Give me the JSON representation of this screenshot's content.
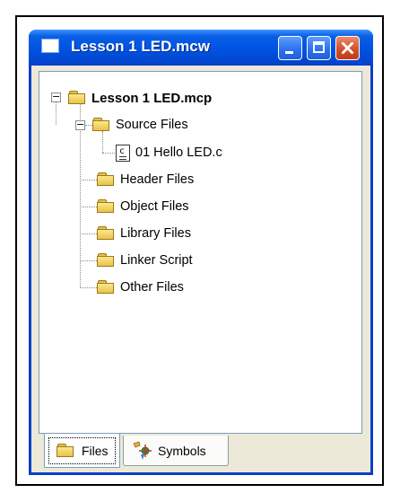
{
  "window": {
    "title": "Lesson 1 LED.mcw",
    "buttons": [
      "minimize",
      "maximize",
      "close"
    ]
  },
  "tree": {
    "project": "Lesson 1 LED.mcp",
    "source_folder": "Source Files",
    "source_file": "01 Hello LED.c",
    "folders": [
      "Header Files",
      "Object Files",
      "Library Files",
      "Linker Script",
      "Other Files"
    ]
  },
  "tabs": {
    "files": "Files",
    "symbols": "Symbols",
    "active": "Files"
  },
  "colors": {
    "titlebar": "#0054e3",
    "close_button": "#d4502c",
    "folder": "#f1d56a"
  }
}
